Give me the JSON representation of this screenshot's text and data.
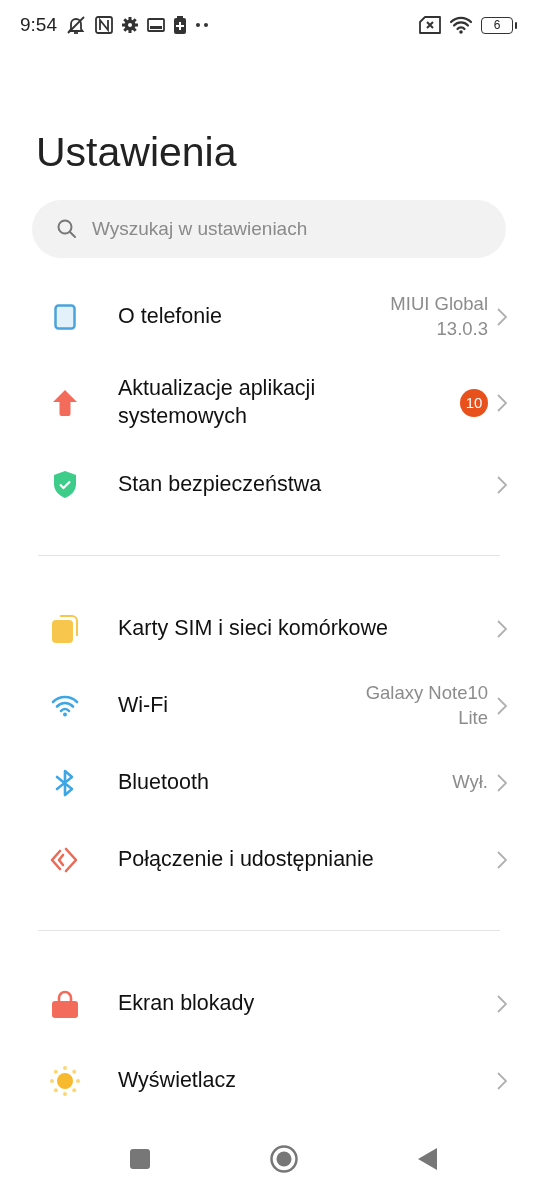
{
  "status_bar": {
    "time": "9:54",
    "battery": "6"
  },
  "title": "Ustawienia",
  "search": {
    "placeholder": "Wyszukaj w ustawieniach"
  },
  "groups": [
    {
      "items": [
        {
          "kind": "phone",
          "label": "O telefonie",
          "value": "MIUI Global 13.0.3"
        },
        {
          "kind": "update",
          "label": "Aktualizacje aplikacji systemowych",
          "badge": "10"
        },
        {
          "kind": "security",
          "label": "Stan bezpieczeństwa"
        }
      ]
    },
    {
      "items": [
        {
          "kind": "sim",
          "label": "Karty SIM i sieci komórkowe"
        },
        {
          "kind": "wifi",
          "label": "Wi-Fi",
          "value": "Galaxy Note10 Lite"
        },
        {
          "kind": "bluetooth",
          "label": "Bluetooth",
          "value": "Wył."
        },
        {
          "kind": "share",
          "label": "Połączenie i udostępnianie"
        }
      ]
    },
    {
      "items": [
        {
          "kind": "lock",
          "label": "Ekran blokady"
        },
        {
          "kind": "display",
          "label": "Wyświetlacz"
        }
      ]
    }
  ]
}
